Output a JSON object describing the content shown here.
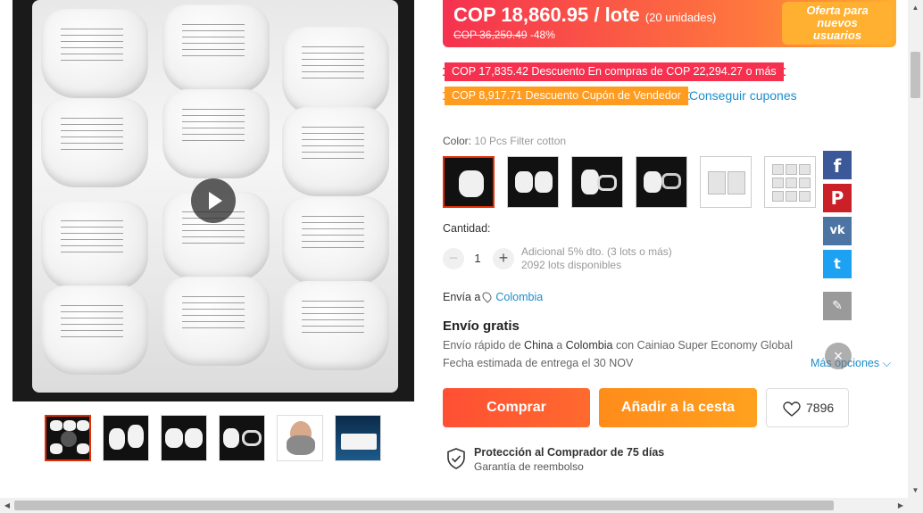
{
  "price": {
    "current": "COP 18,860.95 / lote",
    "units": "(20 unidades)",
    "original": "COP 36,250.49",
    "discount": "-48%",
    "promo_line1": "Oferta para",
    "promo_line2": "nuevos",
    "promo_line3": "usuarios"
  },
  "coupons": {
    "store_discount": "COP 17,835.42 Descuento En compras de COP 22,294.27 o más",
    "seller_coupon": "COP 8,917.71 Descuento Cupón de Vendedor",
    "get_coupons_label": "Conseguir cupones"
  },
  "color": {
    "label": "Color:",
    "selected": "10 Pcs Filter cotton"
  },
  "quantity": {
    "label": "Cantidad:",
    "value": "1",
    "minus": "−",
    "plus": "+",
    "note_line1": "Adicional 5% dto. (3 lots o más)",
    "note_line2": "2092 lots disponibles"
  },
  "shipping": {
    "ship_to_label": "Envía a",
    "country": "Colombia",
    "free_title": "Envío gratis",
    "line1_pre": "Envío rápido de",
    "line1_from": "China",
    "line1_mid": "a",
    "line1_to": "Colombia",
    "line1_post": "con Cainiao Super Economy Global",
    "line2": "Fecha estimada de entrega el 30 NOV",
    "more_options": "Más opciones ⌵"
  },
  "actions": {
    "buy": "Comprar",
    "add_to_cart": "Añadir a la cesta",
    "wishlist_count": "7896"
  },
  "protection": {
    "title": "Protección al Comprador de 75 días",
    "subtitle": "Garantía de reembolso"
  },
  "social": {
    "facebook": "f",
    "pinterest": "P",
    "vk": "vk",
    "twitter": "t",
    "edit": "✎"
  },
  "misc": {
    "close": "×",
    "scroll_up": "▲",
    "scroll_down": "▼",
    "scroll_left": "◀",
    "scroll_right": "▶"
  },
  "colors": {
    "accent_red": "#f5314f",
    "accent_orange": "#ff9b1e",
    "link_blue": "#1a8ecc"
  },
  "icons": [
    "play-icon",
    "location-pin-icon",
    "heart-icon",
    "shield-check-icon",
    "facebook-icon",
    "pinterest-icon",
    "vk-icon",
    "twitter-icon",
    "edit-icon",
    "close-icon"
  ]
}
